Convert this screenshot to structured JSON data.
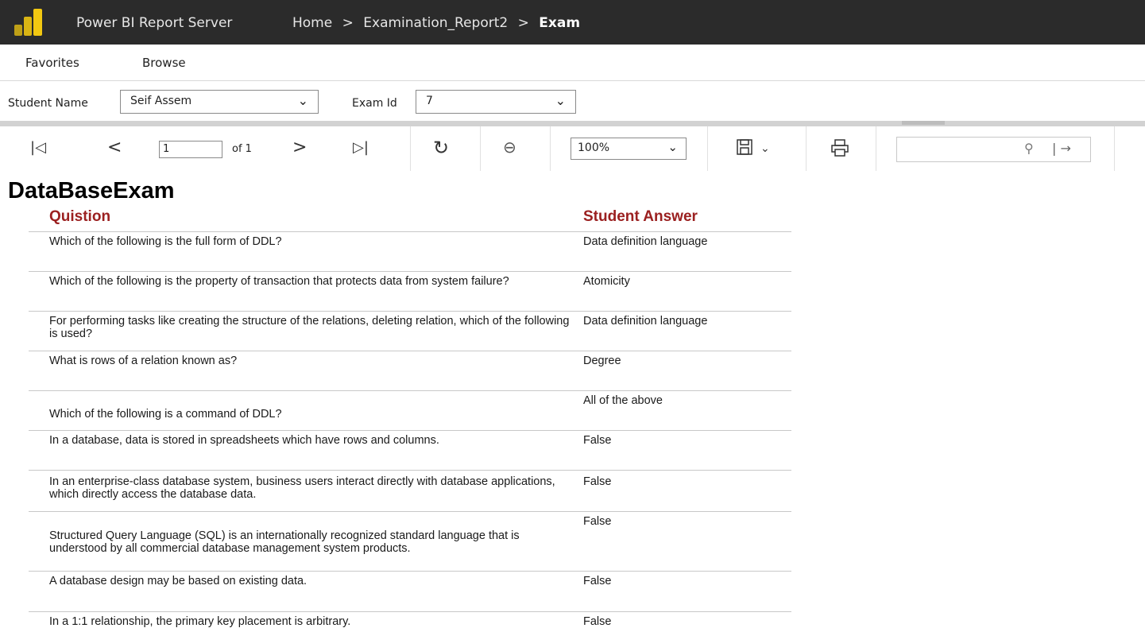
{
  "header": {
    "app_title": "Power BI Report Server",
    "breadcrumbs": [
      "Home",
      "Examination_Report2",
      "Exam"
    ],
    "separator": ">",
    "logo_color": "#f2c811"
  },
  "nav": {
    "items": [
      "Favorites",
      "Browse"
    ]
  },
  "params": {
    "student_name_label": "Student Name",
    "student_name_value": "Seif Assem",
    "exam_id_label": "Exam Id",
    "exam_id_value": "7"
  },
  "toolbar": {
    "page_value": "1",
    "page_of": "of 1",
    "zoom_value": "100%",
    "search_value": "",
    "icons": [
      "first-page-icon",
      "previous-page-icon",
      "next-page-icon",
      "last-page-icon",
      "refresh-icon",
      "back-icon",
      "save-icon",
      "print-icon",
      "search-icon",
      "find-next-icon"
    ]
  },
  "report": {
    "title": "DataBaseExam",
    "question_header": "Quistion",
    "answer_header": "Student Answer",
    "header_color": "#9b2020",
    "rows": [
      {
        "question": "Which of the following is the full form of DDL?",
        "answer": "Data definition language"
      },
      {
        "question": "Which of the following is the property of transaction that protects data from system failure?",
        "answer": "Atomicity"
      },
      {
        "question": "For performing tasks like creating the structure of the relations, deleting relation, which of the following is used?",
        "answer": "Data definition language"
      },
      {
        "question": "What is rows of a relation known as?",
        "answer": "Degree"
      },
      {
        "question": "Which of the following is a command of  DDL?",
        "answer": "All of the above"
      },
      {
        "question": "In a database, data is stored in spreadsheets which have rows and columns.",
        "answer": "False"
      },
      {
        "question": "In an enterprise-class database system, business users interact directly with database applications, which directly access the database data.",
        "answer": "False"
      },
      {
        "question": "Structured Query Language (SQL) is an internationally recognized standard language that is understood by all commercial database management system products.",
        "answer": "False"
      },
      {
        "question": "A database design may be based on existing data.",
        "answer": "False"
      },
      {
        "question": "In a 1:1 relationship, the primary key placement is arbitrary.",
        "answer": "False"
      }
    ]
  }
}
